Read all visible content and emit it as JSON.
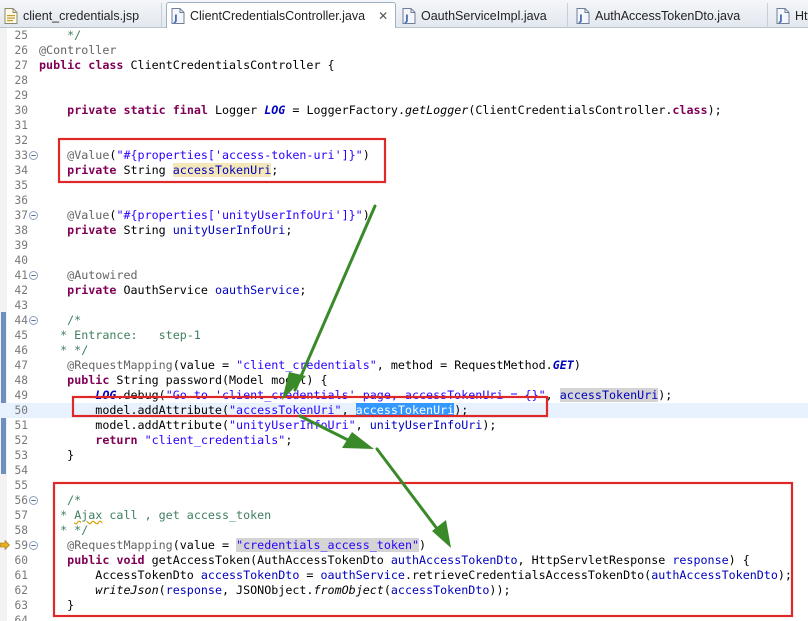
{
  "tabs": [
    {
      "label": "client_credentials.jsp",
      "icon": "jsp-file-icon",
      "active": false,
      "closable": false
    },
    {
      "label": "ClientCredentialsController.java",
      "icon": "java-file-icon",
      "active": true,
      "closable": true
    },
    {
      "label": "OauthServiceImpl.java",
      "icon": "java-file-icon",
      "active": false,
      "closable": false
    },
    {
      "label": "AuthAccessTokenDto.java",
      "icon": "java-file-icon",
      "active": false,
      "closable": false
    },
    {
      "label": "Http",
      "icon": "java-file-icon",
      "active": false,
      "closable": false
    }
  ],
  "close_glyph": "✕",
  "colors": {
    "keyword": "#7f0055",
    "annotation": "#646464",
    "string": "#2a00ff",
    "comment": "#3f7f5f",
    "field": "#0000c0",
    "annotation_box": "#e02828",
    "annotation_arrow": "#3a8a2a",
    "selection": "#3399ff"
  },
  "editor": {
    "lines": [
      {
        "n": "25",
        "fold": "",
        "tokens": [
          {
            "t": "    */",
            "c": "c"
          }
        ]
      },
      {
        "n": "26",
        "fold": "",
        "tokens": [
          {
            "t": "@Controller",
            "c": "an"
          }
        ]
      },
      {
        "n": "27",
        "fold": "",
        "tokens": [
          {
            "t": "public",
            "c": "k"
          },
          {
            "t": " "
          },
          {
            "t": "class",
            "c": "k"
          },
          {
            "t": " ClientCredentialsController {"
          }
        ]
      },
      {
        "n": "28",
        "fold": "",
        "tokens": []
      },
      {
        "n": "29",
        "fold": "",
        "tokens": []
      },
      {
        "n": "30",
        "fold": "",
        "tokens": [
          {
            "t": "    "
          },
          {
            "t": "private",
            "c": "k"
          },
          {
            "t": " "
          },
          {
            "t": "static",
            "c": "k"
          },
          {
            "t": " "
          },
          {
            "t": "final",
            "c": "k"
          },
          {
            "t": " Logger "
          },
          {
            "t": "LOG",
            "c": "st"
          },
          {
            "t": " = LoggerFactory."
          },
          {
            "t": "getLogger",
            "c": "it"
          },
          {
            "t": "(ClientCredentialsController."
          },
          {
            "t": "class",
            "c": "k"
          },
          {
            "t": ");"
          }
        ]
      },
      {
        "n": "31",
        "fold": "",
        "tokens": []
      },
      {
        "n": "32",
        "fold": "",
        "tokens": []
      },
      {
        "n": "33",
        "fold": "minus",
        "tokens": [
          {
            "t": "    "
          },
          {
            "t": "@Value",
            "c": "an"
          },
          {
            "t": "("
          },
          {
            "t": "\"#{properties['access-token-uri']}\"",
            "c": "s"
          },
          {
            "t": ")"
          }
        ]
      },
      {
        "n": "34",
        "fold": "",
        "tokens": [
          {
            "t": "    "
          },
          {
            "t": "private",
            "c": "k"
          },
          {
            "t": " String "
          },
          {
            "t": "accessTokenUri",
            "c": "f hlo"
          },
          {
            "t": ";"
          }
        ]
      },
      {
        "n": "35",
        "fold": "",
        "tokens": []
      },
      {
        "n": "36",
        "fold": "",
        "tokens": []
      },
      {
        "n": "37",
        "fold": "minus",
        "tokens": [
          {
            "t": "    "
          },
          {
            "t": "@Value",
            "c": "an"
          },
          {
            "t": "("
          },
          {
            "t": "\"#{properties['unityUserInfoUri']}\"",
            "c": "s"
          },
          {
            "t": ")"
          }
        ]
      },
      {
        "n": "38",
        "fold": "",
        "tokens": [
          {
            "t": "    "
          },
          {
            "t": "private",
            "c": "k"
          },
          {
            "t": " String "
          },
          {
            "t": "unityUserInfoUri",
            "c": "f"
          },
          {
            "t": ";"
          }
        ]
      },
      {
        "n": "39",
        "fold": "",
        "tokens": []
      },
      {
        "n": "40",
        "fold": "",
        "tokens": []
      },
      {
        "n": "41",
        "fold": "minus",
        "tokens": [
          {
            "t": "    "
          },
          {
            "t": "@Autowired",
            "c": "an"
          }
        ]
      },
      {
        "n": "42",
        "fold": "",
        "tokens": [
          {
            "t": "    "
          },
          {
            "t": "private",
            "c": "k"
          },
          {
            "t": " OauthService "
          },
          {
            "t": "oauthService",
            "c": "f"
          },
          {
            "t": ";"
          }
        ]
      },
      {
        "n": "43",
        "fold": "",
        "tokens": []
      },
      {
        "n": "44",
        "fold": "minus",
        "tokens": [
          {
            "t": "    /*",
            "c": "c"
          }
        ]
      },
      {
        "n": "45",
        "fold": "",
        "tokens": [
          {
            "t": "   * Entrance:   step-1",
            "c": "c"
          }
        ]
      },
      {
        "n": "46",
        "fold": "",
        "tokens": [
          {
            "t": "   * */",
            "c": "c"
          }
        ]
      },
      {
        "n": "47",
        "fold": "",
        "tokens": [
          {
            "t": "    "
          },
          {
            "t": "@RequestMapping",
            "c": "an"
          },
          {
            "t": "(value = "
          },
          {
            "t": "\"client_credentials\"",
            "c": "s"
          },
          {
            "t": ", method = RequestMethod."
          },
          {
            "t": "GET",
            "c": "st"
          },
          {
            "t": ")"
          }
        ]
      },
      {
        "n": "48",
        "fold": "",
        "tokens": [
          {
            "t": "    "
          },
          {
            "t": "public",
            "c": "k"
          },
          {
            "t": " String password(Model model) {"
          }
        ]
      },
      {
        "n": "49",
        "fold": "",
        "tokens": [
          {
            "t": "        "
          },
          {
            "t": "LOG",
            "c": "st"
          },
          {
            "t": ".debug("
          },
          {
            "t": "\"Go to 'client_credentials' page, accessTokenUri = {}\"",
            "c": "s"
          },
          {
            "t": ", "
          },
          {
            "t": "accessTokenUri",
            "c": "f hl"
          },
          {
            "t": ");"
          }
        ]
      },
      {
        "n": "50",
        "fold": "",
        "current": true,
        "tokens": [
          {
            "t": "        model.addAttribute("
          },
          {
            "t": "\"accessTokenUri\"",
            "c": "s"
          },
          {
            "t": ", "
          },
          {
            "t": "accessTokenUri",
            "c": "sel"
          },
          {
            "t": ");"
          }
        ]
      },
      {
        "n": "51",
        "fold": "",
        "tokens": [
          {
            "t": "        model.addAttribute("
          },
          {
            "t": "\"unityUserInfoUri\"",
            "c": "s"
          },
          {
            "t": ", "
          },
          {
            "t": "unityUserInfoUri",
            "c": "f"
          },
          {
            "t": ");"
          }
        ]
      },
      {
        "n": "52",
        "fold": "",
        "tokens": [
          {
            "t": "        "
          },
          {
            "t": "return",
            "c": "k"
          },
          {
            "t": " "
          },
          {
            "t": "\"client_credentials\"",
            "c": "s"
          },
          {
            "t": ";"
          }
        ]
      },
      {
        "n": "53",
        "fold": "",
        "tokens": [
          {
            "t": "    }"
          }
        ]
      },
      {
        "n": "54",
        "fold": "",
        "tokens": []
      },
      {
        "n": "55",
        "fold": "",
        "tokens": []
      },
      {
        "n": "56",
        "fold": "minus",
        "tokens": [
          {
            "t": "    /*",
            "c": "c"
          }
        ]
      },
      {
        "n": "57",
        "fold": "",
        "tokens": [
          {
            "t": "   * ",
            "c": "c"
          },
          {
            "t": "Ajax",
            "c": "c squig"
          },
          {
            "t": " call , get access_token",
            "c": "c"
          }
        ]
      },
      {
        "n": "58",
        "fold": "",
        "tokens": [
          {
            "t": "   * */",
            "c": "c"
          }
        ]
      },
      {
        "n": "59",
        "fold": "minus",
        "marker": true,
        "tokens": [
          {
            "t": "    "
          },
          {
            "t": "@RequestMapping",
            "c": "an"
          },
          {
            "t": "(value = "
          },
          {
            "t": "\"credentials_access_token\"",
            "c": "s hl"
          },
          {
            "t": ")"
          }
        ]
      },
      {
        "n": "60",
        "fold": "",
        "tokens": [
          {
            "t": "    "
          },
          {
            "t": "public",
            "c": "k"
          },
          {
            "t": " "
          },
          {
            "t": "void",
            "c": "k"
          },
          {
            "t": " getAccessToken(AuthAccessTokenDto "
          },
          {
            "t": "authAccessTokenDto",
            "c": "f"
          },
          {
            "t": ", HttpServletResponse "
          },
          {
            "t": "response",
            "c": "f"
          },
          {
            "t": ") {"
          }
        ]
      },
      {
        "n": "61",
        "fold": "",
        "tokens": [
          {
            "t": "        AccessTokenDto "
          },
          {
            "t": "accessTokenDto",
            "c": "f"
          },
          {
            "t": " = "
          },
          {
            "t": "oauthService",
            "c": "f"
          },
          {
            "t": ".retrieveCredentialsAccessTokenDto("
          },
          {
            "t": "authAccessTokenDto",
            "c": "f"
          },
          {
            "t": ");"
          }
        ]
      },
      {
        "n": "62",
        "fold": "",
        "tokens": [
          {
            "t": "        "
          },
          {
            "t": "writeJson",
            "c": "it"
          },
          {
            "t": "("
          },
          {
            "t": "response",
            "c": "f"
          },
          {
            "t": ", JSONObject."
          },
          {
            "t": "fromObject",
            "c": "it"
          },
          {
            "t": "("
          },
          {
            "t": "accessTokenDto",
            "c": "f"
          },
          {
            "t": "));"
          }
        ]
      },
      {
        "n": "63",
        "fold": "",
        "tokens": [
          {
            "t": "    }"
          }
        ]
      },
      {
        "n": "64",
        "fold": "",
        "tokens": []
      }
    ]
  }
}
